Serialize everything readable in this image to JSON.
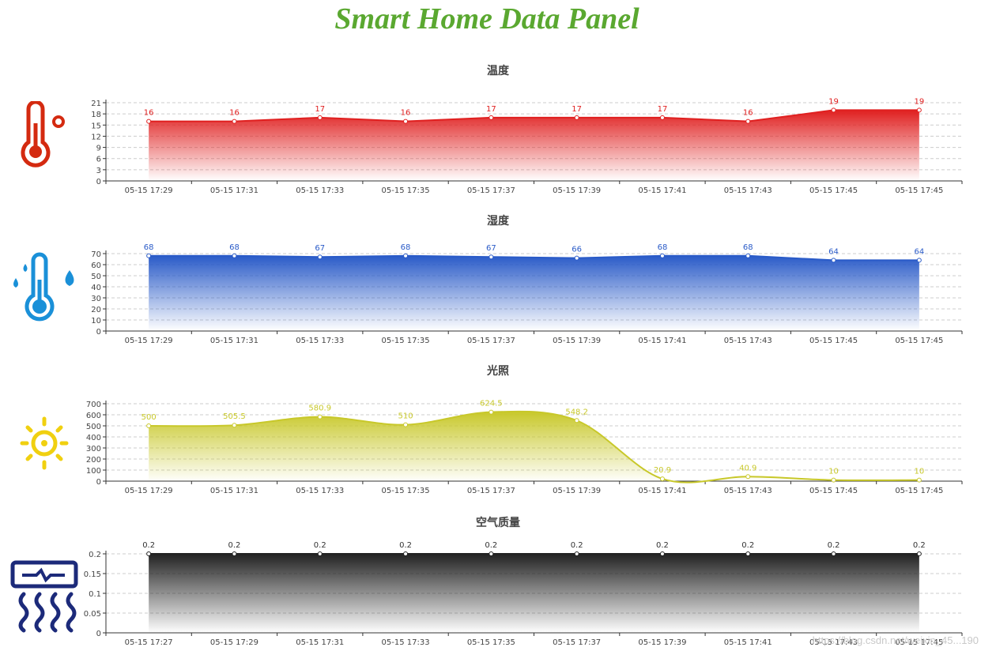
{
  "page": {
    "title": "Smart Home Data Panel"
  },
  "watermark": "https://blog.csdn.net/weixin_45...190",
  "colors": {
    "title": "#5aa830",
    "temperature": "#e02020",
    "humidity": "#2a5bc8",
    "light": "#c8c82a",
    "air": "#222222"
  },
  "icons": [
    "thermometer-icon",
    "humidity-thermometer-icon",
    "sun-icon",
    "air-conditioner-icon"
  ],
  "chart_data": [
    {
      "type": "area",
      "title": "温度",
      "color": "#e02020",
      "grid": true,
      "x": [
        "05-15  17:29",
        "05-15  17:31",
        "05-15  17:33",
        "05-15  17:35",
        "05-15  17:37",
        "05-15  17:39",
        "05-15  17:41",
        "05-15  17:43",
        "05-15  17:45",
        "05-15  17:45"
      ],
      "values": [
        16,
        16,
        17,
        16,
        17,
        17,
        17,
        16,
        19,
        19
      ],
      "labels": [
        "16",
        "16",
        "17",
        "16",
        "17",
        "17",
        "17",
        "16",
        "19",
        "19"
      ],
      "yticks": [
        "0",
        "3",
        "6",
        "9",
        "12",
        "15",
        "18",
        "21"
      ],
      "ylim": [
        0,
        21
      ],
      "smooth": false
    },
    {
      "type": "area",
      "title": "湿度",
      "color": "#2a5bc8",
      "grid": true,
      "x": [
        "05-15  17:29",
        "05-15  17:31",
        "05-15  17:33",
        "05-15  17:35",
        "05-15  17:37",
        "05-15  17:39",
        "05-15  17:41",
        "05-15  17:43",
        "05-15  17:45",
        "05-15  17:45"
      ],
      "values": [
        68,
        68,
        67,
        68,
        67,
        66,
        68,
        68,
        64,
        64
      ],
      "labels": [
        "68",
        "68",
        "67",
        "68",
        "67",
        "66",
        "68",
        "68",
        "64",
        "64"
      ],
      "yticks": [
        "0",
        "10",
        "20",
        "30",
        "40",
        "50",
        "60",
        "70"
      ],
      "ylim": [
        0,
        70
      ],
      "smooth": false
    },
    {
      "type": "area",
      "title": "光照",
      "color": "#c8c82a",
      "grid": true,
      "x": [
        "05-15  17:29",
        "05-15  17:31",
        "05-15  17:33",
        "05-15  17:35",
        "05-15  17:37",
        "05-15  17:39",
        "05-15  17:41",
        "05-15  17:43",
        "05-15  17:45",
        "05-15  17:45"
      ],
      "values": [
        500,
        505.5,
        580.9,
        510,
        624.5,
        548.2,
        20.9,
        40.9,
        10,
        10
      ],
      "labels": [
        "500",
        "505.5",
        "580.9",
        "510",
        "624.5",
        "548.2",
        "20.9",
        "40.9",
        "10",
        "10"
      ],
      "yticks": [
        "0",
        "100",
        "200",
        "300",
        "400",
        "500",
        "600",
        "700"
      ],
      "ylim": [
        0,
        700
      ],
      "smooth": true
    },
    {
      "type": "area",
      "title": "空气质量",
      "color": "#222222",
      "grid": true,
      "x": [
        "05-15  17:27",
        "05-15  17:29",
        "05-15  17:31",
        "05-15  17:33",
        "05-15  17:35",
        "05-15  17:37",
        "05-15  17:39",
        "05-15  17:41",
        "05-15  17:43",
        "05-15  17:45"
      ],
      "values": [
        0.2,
        0.2,
        0.2,
        0.2,
        0.2,
        0.2,
        0.2,
        0.2,
        0.2,
        0.2
      ],
      "labels": [
        "0.2",
        "0.2",
        "0.2",
        "0.2",
        "0.2",
        "0.2",
        "0.2",
        "0.2",
        "0.2",
        "0.2"
      ],
      "yticks": [
        "0",
        "0.05",
        "0.1",
        "0.15",
        "0.2"
      ],
      "ylim": [
        0,
        0.2
      ],
      "smooth": false
    }
  ]
}
